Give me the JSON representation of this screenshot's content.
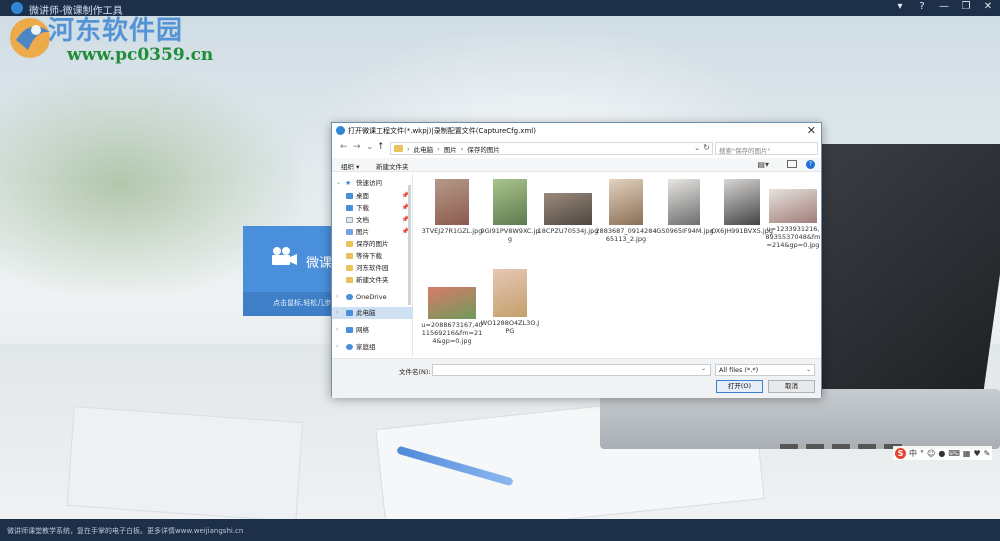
{
  "app": {
    "title": "微讲师-微课制作工具",
    "window_controls": [
      "▾",
      "?",
      "—",
      "❐",
      "✕"
    ]
  },
  "watermark": {
    "name": "河东软件园",
    "url": "www.pc0359.cn"
  },
  "card": {
    "title": "微课",
    "subtitle": "点击鼠标,轻松几步"
  },
  "status": {
    "text": "微讲师课堂教学系统，复在手掌的电子白板。更多详情www.weijiangshi.cn"
  },
  "dialog": {
    "title": "打开微课工程文件(*.wkpj)|录制配置文件(CaptureCfg.xml)",
    "close": "✕",
    "nav": {
      "back": "←",
      "forward": "→",
      "dropdown": "⌄",
      "up": "↑"
    },
    "address": [
      "此电脑",
      "图片",
      "保存的图片"
    ],
    "search_placeholder": "搜索\"保存的图片\"",
    "toolbar": {
      "organize": "组织 ▾",
      "new_folder": "新建文件夹",
      "help": "?"
    },
    "nav_items": [
      {
        "label": "快速访问",
        "icon": "star-icon",
        "expand": true
      },
      {
        "label": "桌面",
        "icon": "folder-icon",
        "pinned": true
      },
      {
        "label": "下载",
        "icon": "download-icon",
        "pinned": true
      },
      {
        "label": "文档",
        "icon": "document-icon",
        "pinned": true
      },
      {
        "label": "图片",
        "icon": "folder-icon",
        "pinned": true
      },
      {
        "label": "保存的图片",
        "icon": "folder-icon"
      },
      {
        "label": "等待下载",
        "icon": "folder-icon"
      },
      {
        "label": "河东软件园",
        "icon": "folder-icon"
      },
      {
        "label": "新建文件夹",
        "icon": "folder-icon"
      },
      {
        "label": "OneDrive",
        "icon": "cloud-icon",
        "expand": true
      },
      {
        "label": "此电脑",
        "icon": "computer-icon",
        "expand": true,
        "selected": true
      },
      {
        "label": "网络",
        "icon": "network-icon",
        "expand": true
      },
      {
        "label": "家庭组",
        "icon": "homegroup-icon",
        "expand": true
      }
    ],
    "files": [
      "3TVEJ27R1GZL.jpg",
      "9GI91PV8W9XC.jpg",
      "18CPZU70534J.jpg",
      "2883687_091428465113_2.jpg",
      "IGS0965IF94M.jpg",
      "OX6JH991BVX5.jpg",
      "u=1233931216,8935537048&fm=214&gp=0.jpg",
      "u=2088673167,4011569216&fm=214&gp=0.jpg",
      "WO1288O4ZL3O.JPG"
    ],
    "filename_label": "文件名(N):",
    "filename_value": "",
    "filetype": "All files (*.*)",
    "open_button": "打开(O)",
    "cancel_button": "取消"
  },
  "ime": {
    "items": [
      "中",
      "°",
      "☺",
      "●",
      "⌨",
      "▦",
      "♥",
      "✎"
    ]
  },
  "colors": {
    "titlebar": "#1e3049",
    "accent": "#2f86d6",
    "card": "#4a8fdb"
  }
}
